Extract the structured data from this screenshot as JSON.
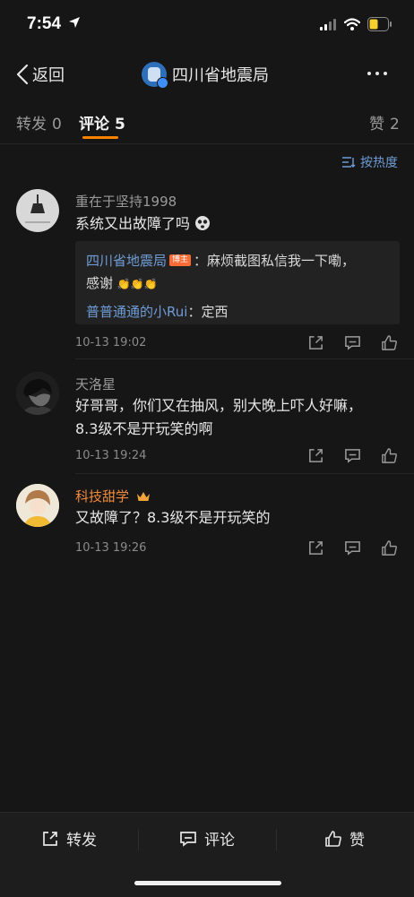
{
  "status": {
    "time": "7:54"
  },
  "nav": {
    "back_label": "返回",
    "title": "四川省地震局"
  },
  "tabs": [
    {
      "label": "转发",
      "count": "0"
    },
    {
      "label": "评论",
      "count": "5"
    },
    {
      "label": "赞",
      "count": "2"
    }
  ],
  "sort_label": "按热度",
  "comments": [
    {
      "username": "重在于坚持1998",
      "text": "系统又出故障了吗",
      "replies": [
        {
          "author": "四川省地震局",
          "badge": "博主",
          "text": "麻烦截图私信我一下嘞，",
          "text2": "感谢"
        },
        {
          "author": "普普通通的小Rui",
          "text": "定西"
        }
      ],
      "time": "10-13 19:02"
    },
    {
      "username": "天洛星",
      "text1": "好哥哥，你们又在抽风，别大晚上吓人好嘛，",
      "text2": "8.3级不是开玩笑的啊",
      "time": "10-13 19:24"
    },
    {
      "username": "科技甜学",
      "text": "又故障了？8.3级不是开玩笑的",
      "time": "10-13 19:26"
    }
  ],
  "bottom": {
    "repost": "转发",
    "comment": "评论",
    "like": "赞"
  },
  "colors": {
    "accent": "#ff8200",
    "link": "#6f9cd6",
    "background": "#161616"
  }
}
